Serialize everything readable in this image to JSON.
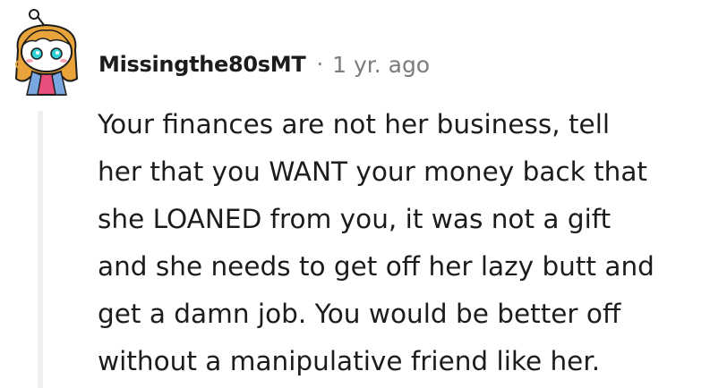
{
  "comment": {
    "author": "Missingthe80sMT",
    "separator": "·",
    "timestamp": "1 yr. ago",
    "avatar_icon": "snoo-avatar-icon",
    "body_lines": [
      "Your finances are not her business, tell",
      "her that you WANT your money back that",
      "she LOANED from you, it was not a gift",
      "and she needs to get off her lazy butt and",
      "get a damn job. You would be better off",
      "without a manipulative friend like her."
    ]
  },
  "colors": {
    "text": "#1c1c1c",
    "meta_text": "#7c7c7c",
    "thread_line": "#edeff1",
    "avatar_hair": "#e8a33a",
    "avatar_eyes": "#2fd0d6",
    "avatar_shirt": "#e84f7c",
    "avatar_jacket": "#7aa7e0"
  }
}
